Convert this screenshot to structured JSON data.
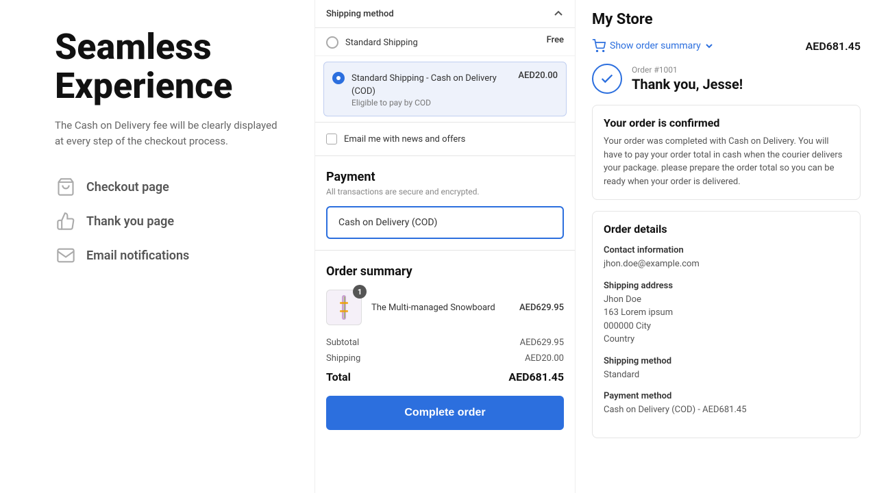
{
  "left": {
    "headline": "Seamless Experience",
    "description": "The Cash on Delivery fee will be clearly displayed at every step of the checkout process.",
    "features": [
      {
        "id": "checkout",
        "icon": "cart",
        "label": "Checkout page"
      },
      {
        "id": "thankyou",
        "icon": "thumbsup",
        "label": "Thank you page"
      },
      {
        "id": "email",
        "icon": "email",
        "label": "Email notifications"
      }
    ]
  },
  "middle": {
    "shipping": {
      "section_label": "Shipping method",
      "options": [
        {
          "id": "standard",
          "name": "Standard Shipping",
          "price": "Free",
          "selected": false
        },
        {
          "id": "cod",
          "name": "Standard Shipping - Cash on Delivery (COD)",
          "sub": "Eligible to pay by COD",
          "price": "AED20.00",
          "selected": true
        }
      ]
    },
    "email_checkbox": {
      "label": "Email me with news and offers",
      "checked": false
    },
    "payment": {
      "title": "Payment",
      "subtitle": "All transactions are secure and encrypted.",
      "method": "Cash on Delivery (COD)"
    },
    "order_summary": {
      "title": "Order summary",
      "product": {
        "name": "The Multi-managed Snowboard",
        "price": "AED629.95",
        "quantity": 1
      },
      "subtotal_label": "Subtotal",
      "subtotal": "AED629.95",
      "shipping_label": "Shipping",
      "shipping": "AED20.00",
      "total_label": "Total",
      "total": "AED681.45",
      "button": "Complete order"
    }
  },
  "right": {
    "store_name": "My Store",
    "show_summary_label": "Show order summary",
    "summary_amount": "AED681.45",
    "order_number": "Order #1001",
    "thank_you": "Thank you, Jesse!",
    "confirmed": {
      "title": "Your order is confirmed",
      "text": "Your order was completed with Cash on Delivery. You will have to pay your order total in cash when the courier delivers your package. please prepare the order total so you can be ready when your order is delivered."
    },
    "order_details": {
      "title": "Order details",
      "contact_label": "Contact information",
      "contact_value": "jhon.doe@example.com",
      "shipping_address_label": "Shipping address",
      "shipping_address": "Jhon Doe\n163 Lorem ipsum\n000000 City\nCountry",
      "shipping_method_label": "Shipping method",
      "shipping_method_value": "Standard",
      "payment_method_label": "Payment method",
      "payment_method_value": "Cash on Delivery (COD) - AED681.45"
    }
  }
}
